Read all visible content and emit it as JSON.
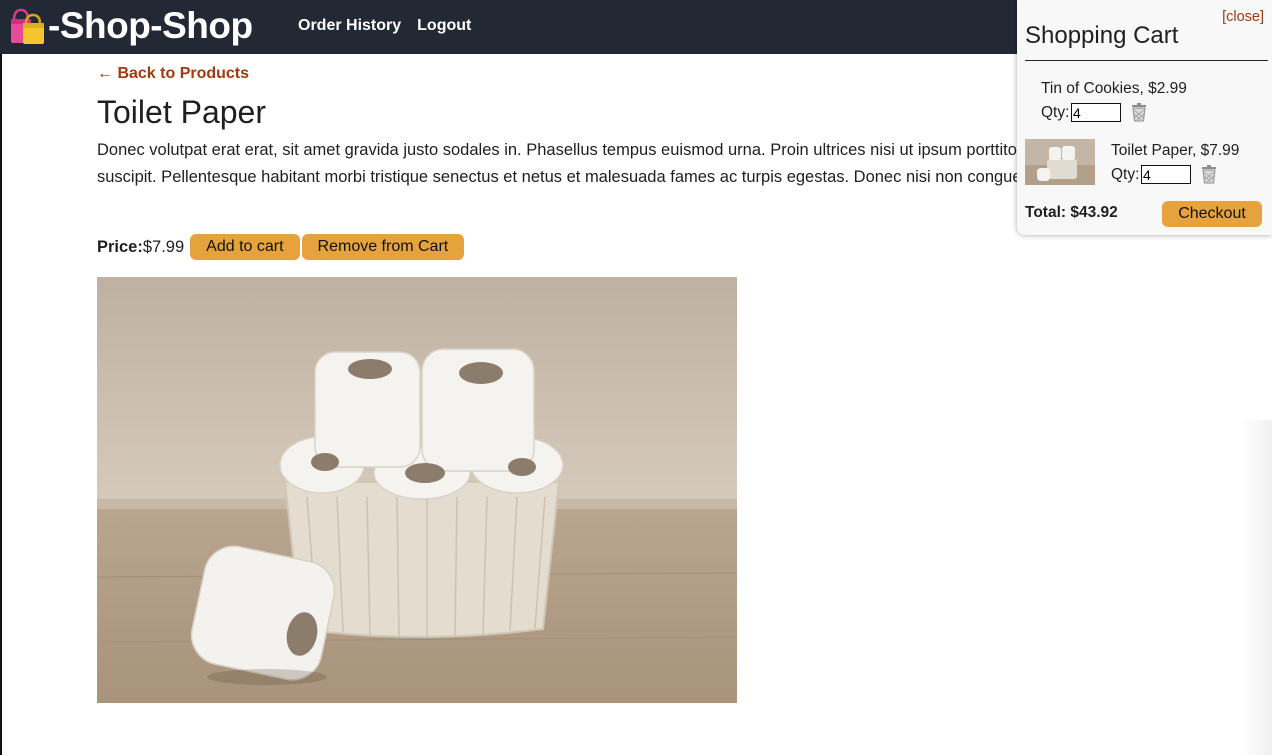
{
  "app": {
    "brand": "-Shop-Shop",
    "brand_icon": "shopping-bags-icon"
  },
  "nav": {
    "order_history": "Order History",
    "logout": "Logout"
  },
  "product": {
    "back_link": "← Back to Products",
    "name": "Toilet Paper",
    "description": "Donec volutpat erat erat, sit amet gravida justo sodales in. Phasellus tempus euismod urna. Proin ultrices nisi ut ipsum porttitor libero suscipit. Pellentesque habitant morbi tristique senectus et netus et malesuada fames ac turpis egestas. Donec nisi non congue.",
    "price_label": "Price:",
    "price_value": "$7.99",
    "add_label": "Add to cart",
    "remove_label": "Remove from Cart",
    "image_alt": "toilet paper rolls in a basket"
  },
  "cart": {
    "close_label": "[close]",
    "title": "Shopping Cart",
    "items": [
      {
        "name": "Tin of Cookies, $2.99",
        "qty_label": "Qty:",
        "qty": "4",
        "has_thumb": false
      },
      {
        "name": "Toilet Paper, $7.99",
        "qty_label": "Qty:",
        "qty": "4",
        "has_thumb": true
      }
    ],
    "total": "Total: $43.92",
    "checkout_label": "Checkout"
  },
  "colors": {
    "header_bg": "#222834",
    "accent_button": "#e6a33d",
    "link": "#a23a0f"
  }
}
